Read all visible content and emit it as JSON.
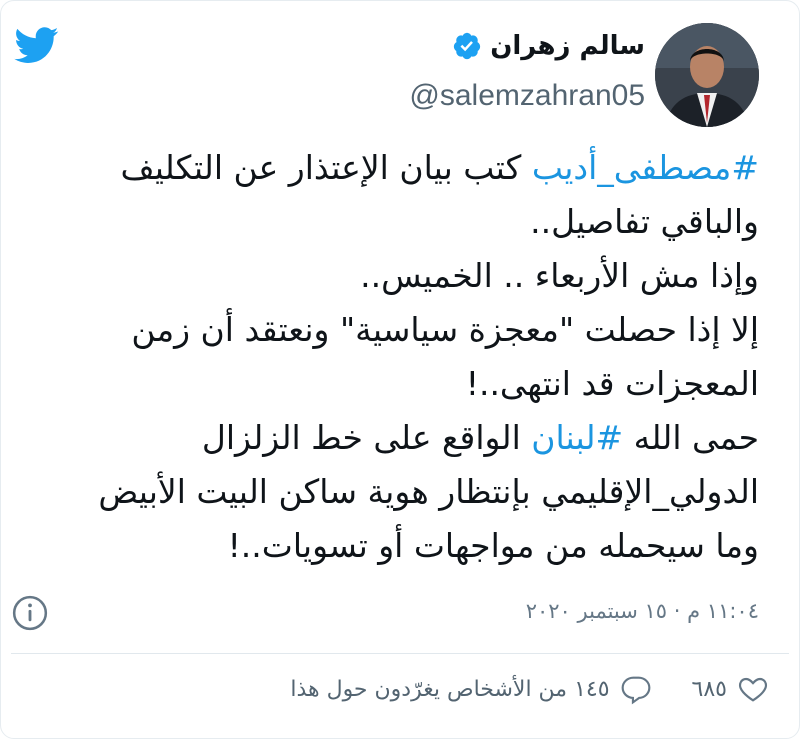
{
  "author": {
    "name": "سالم زهران",
    "handle": "@salemzahran05",
    "verified": true
  },
  "tweet": {
    "lines": [
      {
        "link": "#مصطفى_أديب",
        "rest": " كتب بيان الإعتذار عن التكليف"
      },
      {
        "text": "والباقي تفاصيل.."
      },
      {
        "text": "وإذا مش الأربعاء .. الخميس.."
      },
      {
        "text": "إلا إذا حصلت \"معجزة سياسية\" ونعتقد أن زمن"
      },
      {
        "text": "المعجزات قد انتهى..!"
      },
      {
        "before": "حمى الله ",
        "link": "#لبنان",
        "after": " الواقع على خط الزلزال"
      },
      {
        "text": "الدولي_الإقليمي بإنتظار هوية ساكن البيت الأبيض"
      },
      {
        "text": "وما سيحمله من مواجهات أو تسويات..!"
      }
    ],
    "timestamp": "١١:٠٤ م · ١٥ سبتمبر ٢٠٢٠"
  },
  "actions": {
    "likes": "٦٨٥",
    "talking": "١٤٥ من الأشخاص يغرّدون حول هذا"
  },
  "colors": {
    "brand": "#1da1f2",
    "link": "#1b95e0",
    "muted": "#657786"
  },
  "icons": [
    "twitter-bird-icon",
    "verified-badge-icon",
    "info-icon",
    "heart-icon",
    "reply-icon"
  ]
}
